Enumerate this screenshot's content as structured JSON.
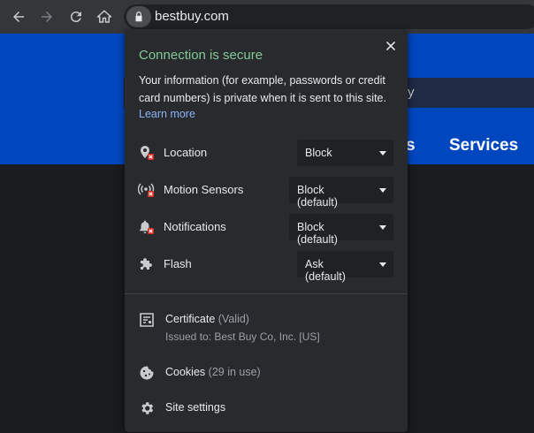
{
  "browser": {
    "url": "bestbuy.com"
  },
  "background_page": {
    "partial_text_right": "y",
    "partial_nav_text": "s",
    "services_label": "Services"
  },
  "popup": {
    "title": "Connection is secure",
    "description": "Your information (for example, passwords or credit card numbers) is private when it is sent to this site.",
    "learn_more": "Learn more",
    "permissions": [
      {
        "label": "Location",
        "value": "Block",
        "icon": "location-blocked-icon"
      },
      {
        "label": "Motion Sensors",
        "value": "Block (default)",
        "icon": "motion-sensors-icon"
      },
      {
        "label": "Notifications",
        "value": "Block (default)",
        "icon": "notifications-blocked-icon"
      },
      {
        "label": "Flash",
        "value": "Ask (default)",
        "icon": "puzzle-icon"
      }
    ],
    "certificate": {
      "label": "Certificate",
      "status": "(Valid)",
      "issued_to": "Issued to: Best Buy Co, Inc. [US]"
    },
    "cookies": {
      "label": "Cookies",
      "count": "(29 in use)"
    },
    "site_settings": "Site settings"
  },
  "colors": {
    "secure_green": "#81c995",
    "link_blue": "#8ab4f8",
    "bestbuy_blue": "#0046be"
  }
}
